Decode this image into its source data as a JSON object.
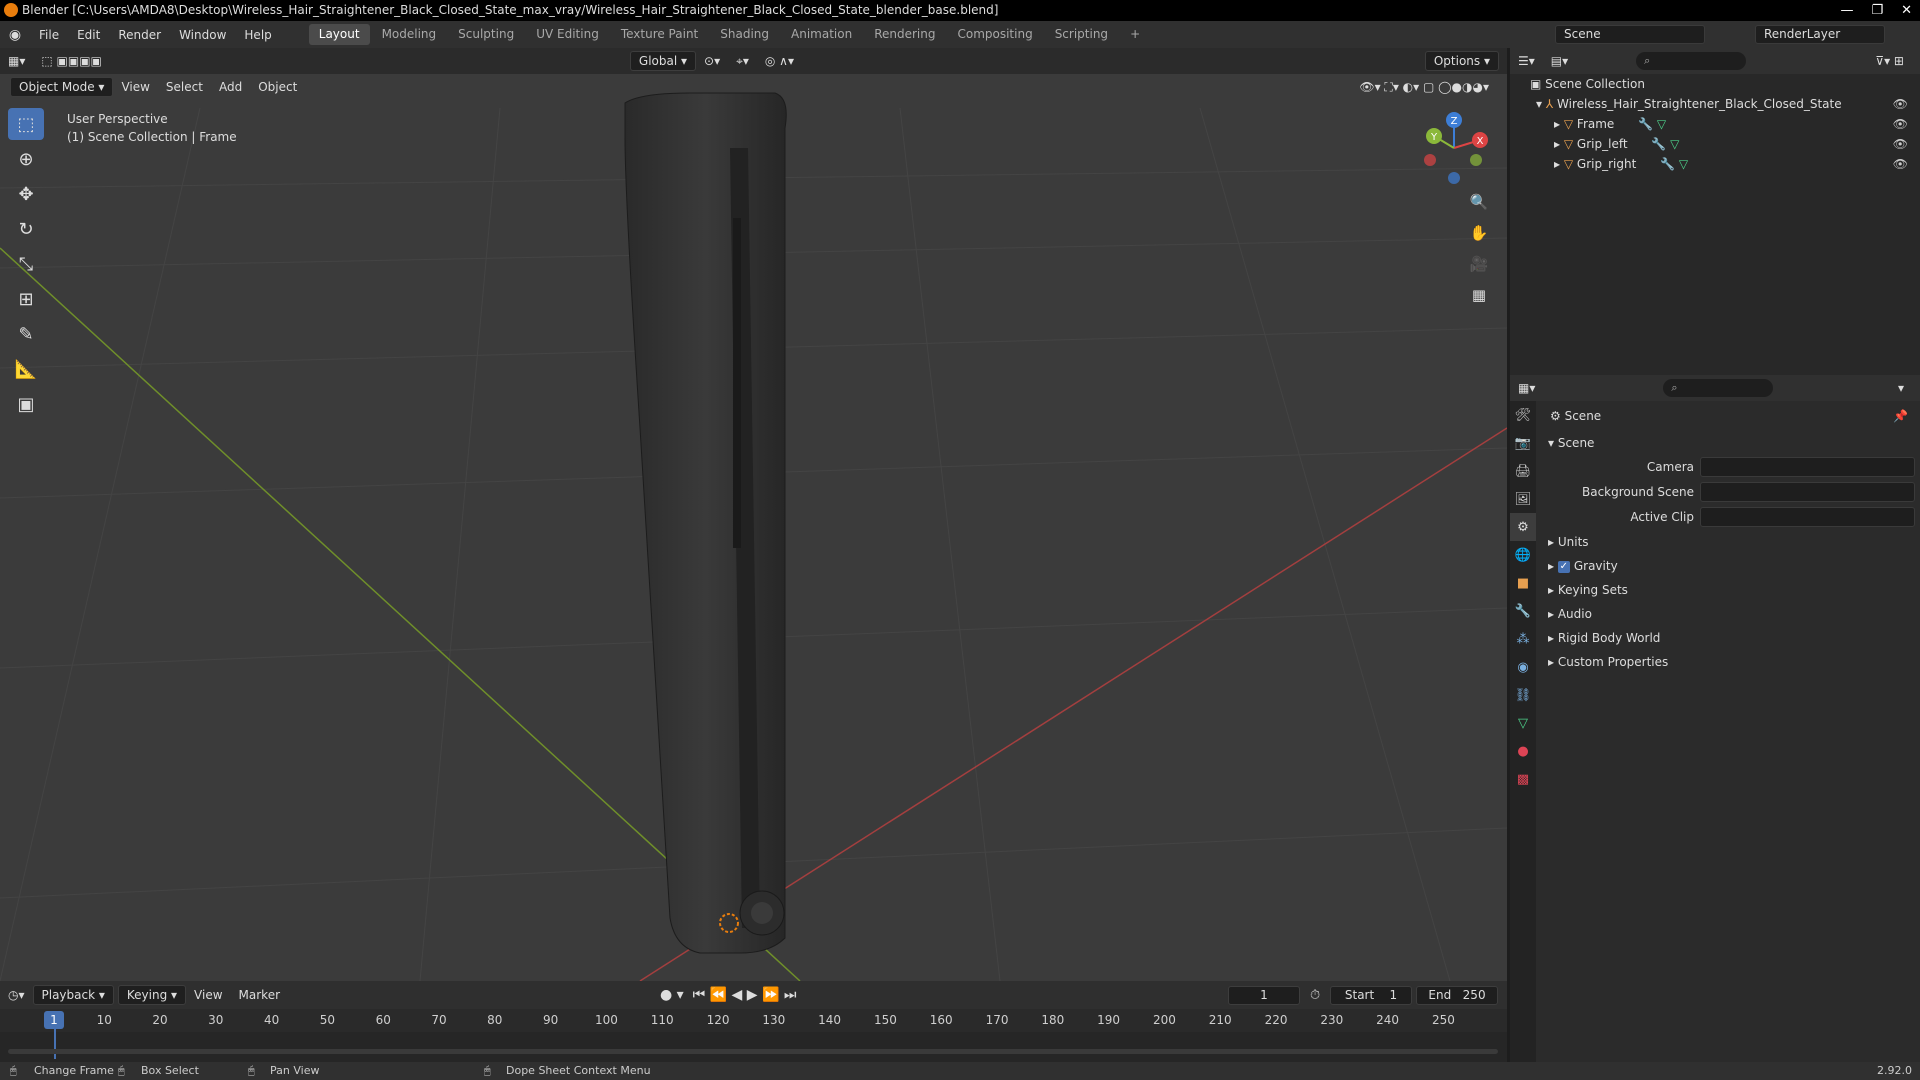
{
  "window": {
    "title": "Blender [C:\\Users\\AMDA8\\Desktop\\Wireless_Hair_Straightener_Black_Closed_State_max_vray/Wireless_Hair_Straightener_Black_Closed_State_blender_base.blend]",
    "minimize": "—",
    "restore": "❐",
    "close": "✕"
  },
  "menu": {
    "file": "File",
    "edit": "Edit",
    "render": "Render",
    "window": "Window",
    "help": "Help"
  },
  "workspaces": [
    {
      "label": "Layout",
      "active": true
    },
    {
      "label": "Modeling",
      "active": false
    },
    {
      "label": "Sculpting",
      "active": false
    },
    {
      "label": "UV Editing",
      "active": false
    },
    {
      "label": "Texture Paint",
      "active": false
    },
    {
      "label": "Shading",
      "active": false
    },
    {
      "label": "Animation",
      "active": false
    },
    {
      "label": "Rendering",
      "active": false
    },
    {
      "label": "Compositing",
      "active": false
    },
    {
      "label": "Scripting",
      "active": false
    }
  ],
  "scene_selector": "Scene",
  "view_layer": "RenderLayer",
  "viewport": {
    "transform_orientation": "Global",
    "options_label": "Options",
    "mode": "Object Mode",
    "view_menu": "View",
    "select_menu": "Select",
    "add_menu": "Add",
    "object_menu": "Object",
    "info_line1": "User Perspective",
    "info_line2": "(1) Scene Collection | Frame",
    "gizmo_x": "X",
    "gizmo_y": "Y",
    "gizmo_z": "Z"
  },
  "timeline": {
    "playback": "Playback",
    "keying": "Keying",
    "view": "View",
    "marker": "Marker",
    "current_frame": "1",
    "start_label": "Start",
    "start_value": "1",
    "end_label": "End",
    "end_value": "250",
    "ticks": [
      "1",
      "10",
      "20",
      "30",
      "40",
      "50",
      "60",
      "70",
      "80",
      "90",
      "100",
      "110",
      "120",
      "130",
      "140",
      "150",
      "160",
      "170",
      "180",
      "190",
      "200",
      "210",
      "220",
      "230",
      "240",
      "250"
    ]
  },
  "statusbar": {
    "change_frame": "Change Frame",
    "box_select": "Box Select",
    "pan_view": "Pan View",
    "context_menu": "Dope Sheet Context Menu",
    "version": "2.92.0"
  },
  "outliner": {
    "root": "Scene Collection",
    "collection": "Wireless_Hair_Straightener_Black_Closed_State",
    "objects": [
      "Frame",
      "Grip_left",
      "Grip_right"
    ]
  },
  "properties": {
    "context_title": "Scene",
    "panel_scene": "Scene",
    "camera_label": "Camera",
    "background_scene_label": "Background Scene",
    "active_clip_label": "Active Clip",
    "subpanels": [
      "Units",
      "Gravity",
      "Keying Sets",
      "Audio",
      "Rigid Body World",
      "Custom Properties"
    ],
    "gravity_checked": true
  },
  "colors": {
    "accent": "#4772b3",
    "x_axis": "#a33f3f",
    "y_axis": "#6f8f2a",
    "blender_orange": "#e87d0d"
  }
}
